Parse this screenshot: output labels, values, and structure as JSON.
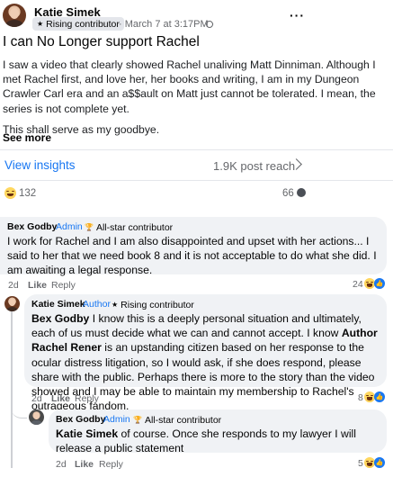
{
  "post": {
    "author": "Katie Simek",
    "author_badge": "Rising contributor",
    "timestamp": "· March 7 at 3:17PM ·",
    "title": "I can No Longer support Rachel",
    "paragraphs": [
      "I saw a video that clearly showed Rachel unaliving Matt Dinniman. Although I met Rachel first, and love her, her books and writing, I am in my Dungeon Crawler Carl era and an a$$ault on Matt just cannot be tolerated. I mean, the series is not complete yet.",
      "This shall serve as my goodbye."
    ],
    "see_more": "See more",
    "view_insights": "View insights",
    "post_reach": "1.9K post reach",
    "reaction_count": "132",
    "comment_count": "66",
    "more_icon": "more-options-icon",
    "audience_icon": "globe-icon"
  },
  "comments": [
    {
      "author": "Bex Godby",
      "role": "Admin",
      "badge": "All-star contributor",
      "text": "I work for Rachel and I am also disappointed and upset with her actions... I said to her that we need book 8 and it is not acceptable to do what she did. I am awaiting a legal response.",
      "time": "2d",
      "like": "Like",
      "reply": "Reply",
      "reactions": "24"
    },
    {
      "author": "Katie Simek",
      "role": "Author",
      "badge": "Rising contributor",
      "mention": "Bex Godby",
      "text_a": " I know this is a deeply personal situation and ultimately, each of us must decide what we can and cannot accept. I know ",
      "mention2": "Author Rachel Rener",
      "text_b": " is an upstanding citizen based on her response to the ocular distress litigation, so I would ask, if she does respond, please share with the public. Perhaps there is more to the story than the video showed and I may be able to maintain my membership to Rachel's outrageous fandom.",
      "time": "2d",
      "like": "Like",
      "reply": "Reply",
      "reactions": "8"
    },
    {
      "author": "Bex Godby",
      "role": "Admin",
      "badge": "All-star contributor",
      "mention": "Katie Simek",
      "text": " of course. Once she responds to my lawyer I will release a public statement",
      "time": "2d",
      "like": "Like",
      "reply": "Reply",
      "reactions": "5"
    }
  ],
  "colors": {
    "link_blue": "#1877f2",
    "secondary_text": "#65676b",
    "bubble_bg": "#f0f2f5",
    "like_blue": "#1877f2"
  }
}
